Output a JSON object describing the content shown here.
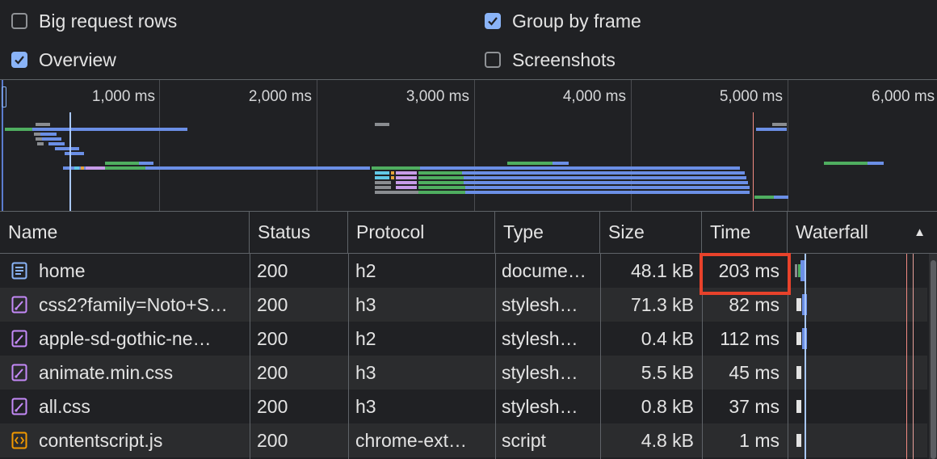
{
  "options": {
    "big_request_rows": {
      "label": "Big request rows",
      "checked": false
    },
    "group_by_frame": {
      "label": "Group by frame",
      "checked": true
    },
    "overview": {
      "label": "Overview",
      "checked": true
    },
    "screenshots": {
      "label": "Screenshots",
      "checked": false
    }
  },
  "overview": {
    "ticks": [
      "1,000 ms",
      "2,000 ms",
      "3,000 ms",
      "4,000 ms",
      "5,000 ms",
      "6,000 ms"
    ]
  },
  "table": {
    "columns": {
      "name": "Name",
      "status": "Status",
      "protocol": "Protocol",
      "type": "Type",
      "size": "Size",
      "time": "Time",
      "waterfall": "Waterfall"
    },
    "sort_indicator": "▲",
    "rows": [
      {
        "icon": "document-icon",
        "name": "home",
        "status": "200",
        "protocol": "h2",
        "type": "docume…",
        "size": "48.1 kB",
        "time": "203 ms"
      },
      {
        "icon": "stylesheet-icon",
        "name": "css2?family=Noto+S…",
        "status": "200",
        "protocol": "h3",
        "type": "stylesh…",
        "size": "71.3 kB",
        "time": "82 ms"
      },
      {
        "icon": "stylesheet-icon",
        "name": "apple-sd-gothic-ne…",
        "status": "200",
        "protocol": "h2",
        "type": "stylesh…",
        "size": "0.4 kB",
        "time": "112 ms"
      },
      {
        "icon": "stylesheet-icon",
        "name": "animate.min.css",
        "status": "200",
        "protocol": "h3",
        "type": "stylesh…",
        "size": "5.5 kB",
        "time": "45 ms"
      },
      {
        "icon": "stylesheet-icon",
        "name": "all.css",
        "status": "200",
        "protocol": "h3",
        "type": "stylesh…",
        "size": "0.8 kB",
        "time": "37 ms"
      },
      {
        "icon": "script-icon",
        "name": "contentscript.js",
        "status": "200",
        "protocol": "chrome-ext…",
        "type": "script",
        "size": "4.8 kB",
        "time": "1 ms"
      }
    ]
  },
  "colors": {
    "background": "#202124",
    "row_alt": "#2b2c2e",
    "checkbox_accent": "#8ab4f8",
    "highlight": "#e8422b",
    "bar_blue": "#6b8fe6",
    "bar_green": "#4fae60"
  }
}
